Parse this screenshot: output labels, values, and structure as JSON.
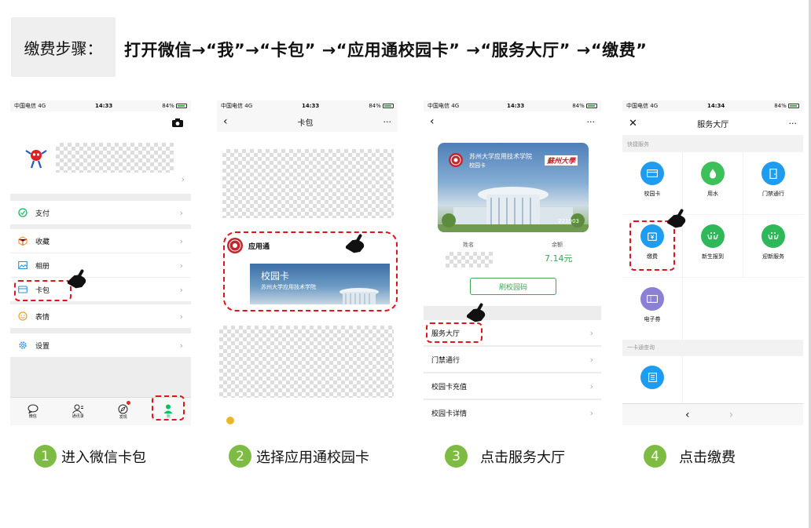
{
  "header": {
    "label": "缴费步骤：",
    "steps": "打开微信→“我”→“卡包” →“应用通校园卡” →“服务大厅” →“缴费”"
  },
  "status_bar": {
    "carrier": "中国电信",
    "network": "4G",
    "battery": "84%"
  },
  "panel1": {
    "time": "14:33",
    "menu": [
      {
        "label": "支付"
      },
      {
        "label": "收藏"
      },
      {
        "label": "相册"
      },
      {
        "label": "卡包"
      },
      {
        "label": "表情"
      },
      {
        "label": "设置"
      }
    ],
    "tabs": [
      "微信",
      "通讯录",
      "发现",
      "我"
    ]
  },
  "panel2": {
    "time": "14:33",
    "title": "卡包",
    "more": "···",
    "app_name": "应用通",
    "card_title": "校园卡",
    "card_school": "苏州大学应用技术学院"
  },
  "panel3": {
    "time": "14:33",
    "more": "···",
    "card_school": "苏州大学应用技术学院",
    "card_type": "校园卡",
    "card_badge": "蘇州大學",
    "card_no": "221903",
    "name_label": "姓名",
    "balance_label": "余额",
    "balance_value": "7.14元",
    "qr_button": "刷校园码",
    "menu": [
      "服务大厅",
      "门禁通行",
      "校园卡充值",
      "校园卡详情"
    ]
  },
  "panel4": {
    "time": "14:34",
    "title": "服务大厅",
    "more": "···",
    "section1": "快捷服务",
    "items": [
      {
        "label": "校园卡",
        "color": "#1e9cf0"
      },
      {
        "label": "用水",
        "color": "#3cc05a"
      },
      {
        "label": "门禁通行",
        "color": "#1e9cf0"
      },
      {
        "label": "缴费",
        "color": "#1e9cf0"
      },
      {
        "label": "新生报到",
        "color": "#2fb85a"
      },
      {
        "label": "迎新服务",
        "color": "#2fb85a"
      },
      {
        "label": "电子券",
        "color": "#8a80d6"
      }
    ],
    "section2": "一卡通查询"
  },
  "steps": [
    {
      "num": "1",
      "label": "进入微信卡包"
    },
    {
      "num": "2",
      "label": "选择应用通校园卡"
    },
    {
      "num": "3",
      "label": "点击服务大厅"
    },
    {
      "num": "4",
      "label": "点击缴费"
    }
  ],
  "colors": {
    "accent": "#7dbb42",
    "highlight": "#e0141a",
    "wechat_green": "#07c160"
  }
}
